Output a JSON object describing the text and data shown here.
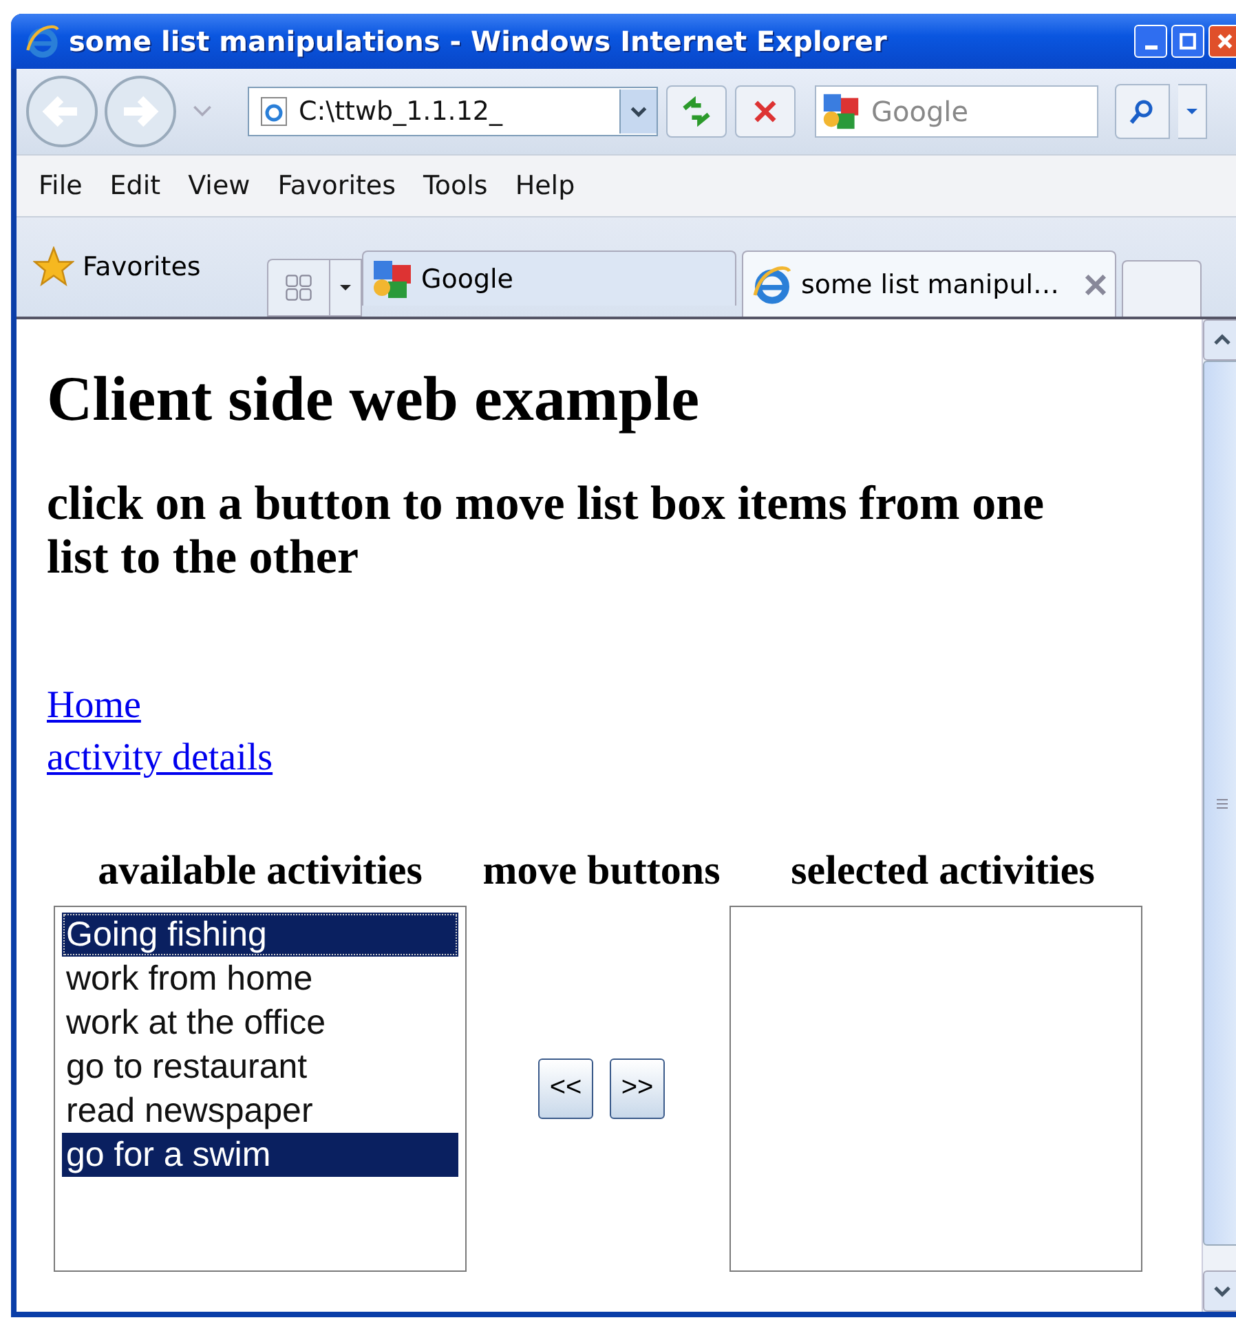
{
  "window": {
    "title": "some list manipulations - Windows Internet Explorer"
  },
  "address_bar": {
    "value": "C:\\ttwb_1.1.12_"
  },
  "search": {
    "placeholder": "Google"
  },
  "menu": [
    "File",
    "Edit",
    "View",
    "Favorites",
    "Tools",
    "Help"
  ],
  "favorites": {
    "label": "Favorites"
  },
  "tabs": [
    {
      "label": "Google",
      "selected": false
    },
    {
      "label": "some list manipul…",
      "selected": true
    }
  ],
  "page": {
    "heading": "Client side web example",
    "subheading": "click on a button to move list box items from one list to the other",
    "links": [
      "Home",
      "activity details"
    ],
    "columns": [
      "available activities",
      "move buttons",
      "selected activities"
    ],
    "available": [
      {
        "label": "Going fishing",
        "selected": true,
        "focused": true
      },
      {
        "label": "work from home",
        "selected": false,
        "focused": false
      },
      {
        "label": "work at the office",
        "selected": false,
        "focused": false
      },
      {
        "label": "go to restaurant",
        "selected": false,
        "focused": false
      },
      {
        "label": "read newspaper",
        "selected": false,
        "focused": false
      },
      {
        "label": "go for a swim",
        "selected": true,
        "focused": false
      }
    ],
    "buttons": [
      "<<",
      ">>"
    ]
  }
}
